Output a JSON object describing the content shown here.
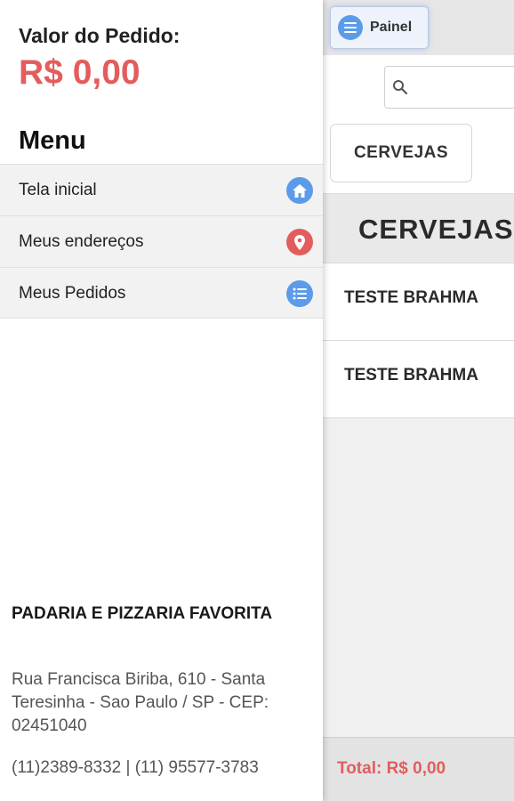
{
  "colors": {
    "accent_red": "#e35d5d",
    "home_icon": "#5b9bea",
    "location_icon": "#e35d5d",
    "orders_icon": "#5b9bea"
  },
  "header": {
    "panel_label": "Painel",
    "panel_icon": "list-icon"
  },
  "search": {
    "placeholder": "",
    "value": ""
  },
  "categories": {
    "tabs": [
      "CERVEJAS"
    ]
  },
  "section": {
    "title": "CERVEJAS"
  },
  "products": [
    {
      "name": "TESTE BRAHMA"
    },
    {
      "name": "TESTE BRAHMA"
    }
  ],
  "footer": {
    "total": "Total: R$ 0,00"
  },
  "sidemenu": {
    "order_label": "Valor do Pedido:",
    "order_value": "R$ 0,00",
    "menu_title": "Menu",
    "items": [
      {
        "label": "Tela inicial",
        "icon": "home-icon"
      },
      {
        "label": "Meus endereços",
        "icon": "location-pin-icon"
      },
      {
        "label": "Meus Pedidos",
        "icon": "list-icon"
      }
    ],
    "store": {
      "name": "PADARIA E PIZZARIA FAVORITA",
      "address": "Rua Francisca Biriba, 610 - Santa Teresinha - Sao Paulo / SP - CEP: 02451040",
      "phone": "(11)2389-8332 | (11) 95577-3783"
    }
  }
}
